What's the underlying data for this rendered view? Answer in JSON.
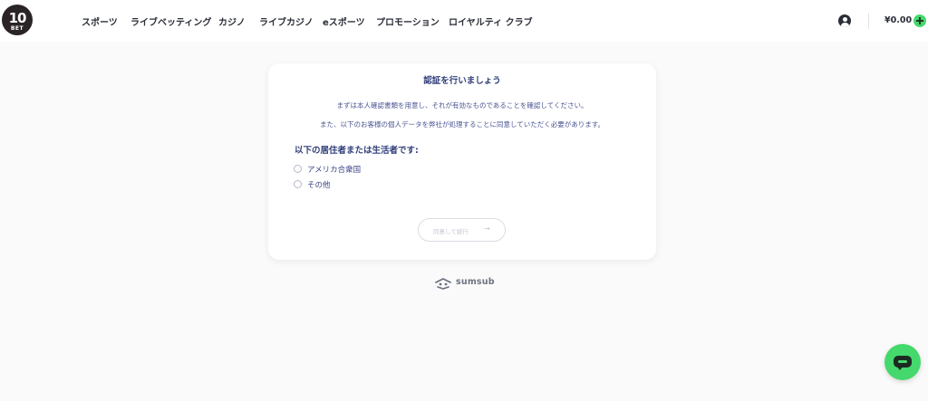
{
  "brand": {
    "logo_text": "10",
    "logo_sub": "BET"
  },
  "nav": {
    "items": [
      {
        "label": "スポーツ"
      },
      {
        "label": "ライブベッティング"
      },
      {
        "label": "カジノ"
      },
      {
        "label": "ライブカジノ"
      },
      {
        "label": "eスポーツ"
      },
      {
        "label": "プロモーション"
      },
      {
        "label": "ロイヤルティ クラブ"
      }
    ]
  },
  "account": {
    "balance": "¥0.00",
    "user_icon": "user-circle-icon",
    "deposit_icon": "plus-icon"
  },
  "verification": {
    "title": "認証を行いましょう",
    "description_1": "まずは本人確認書類を用意し、それが有効なものであることを確認してください。",
    "description_2": "また、以下のお客様の個人データを弊社が処理することに同意していただく必要があります。",
    "question": "以下の居住者または生活者です:",
    "options": [
      {
        "label": "アメリカ合衆国",
        "selected": false
      },
      {
        "label": "その他",
        "selected": false
      }
    ],
    "continue_label": "同意して続行",
    "continue_arrow": "→",
    "continue_enabled": false
  },
  "footer": {
    "provider": "sumsub"
  },
  "chat": {
    "icon": "chat-bubble-icon"
  },
  "colors": {
    "accent_green": "#45d86d",
    "title_blue": "#2f3d79",
    "text_blue": "#4b5592",
    "page_bg": "#fbfafa"
  }
}
